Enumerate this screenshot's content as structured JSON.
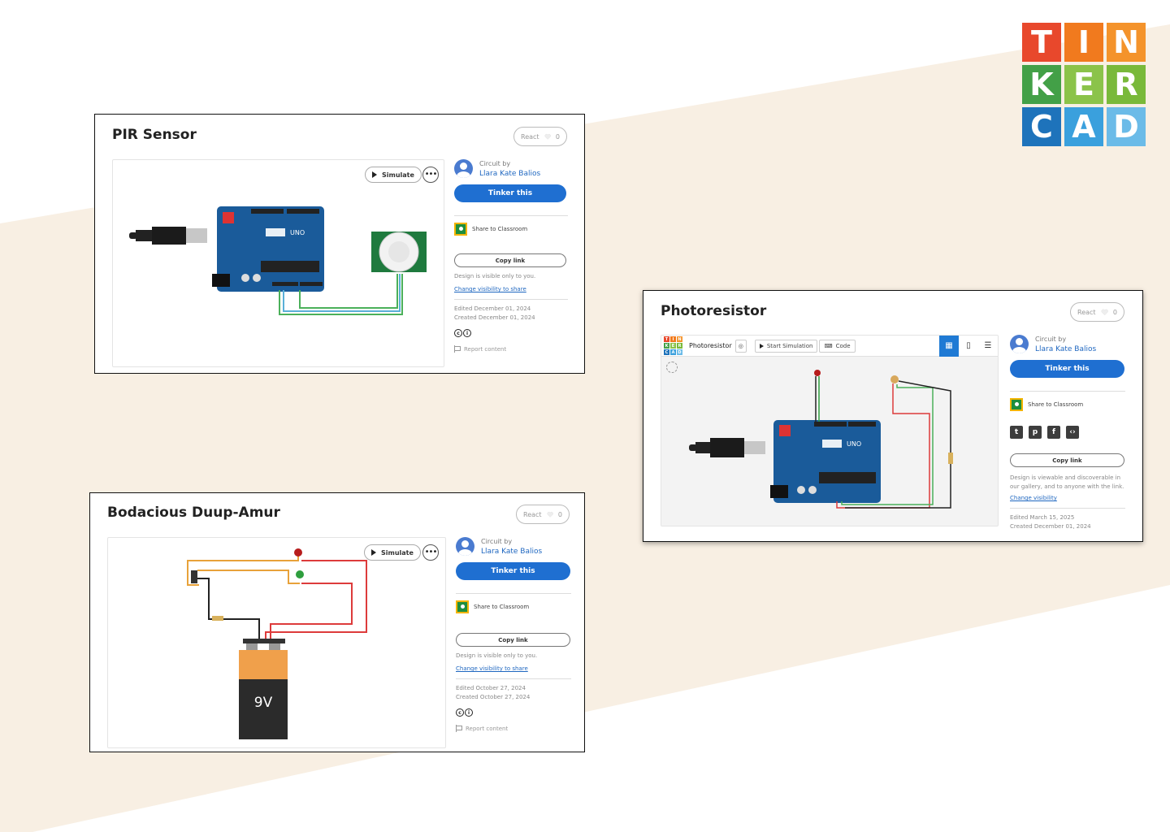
{
  "brand": {
    "logo_letters": [
      "T",
      "I",
      "N",
      "K",
      "E",
      "R",
      "C",
      "A",
      "D"
    ],
    "logo_colors": [
      "#e8482c",
      "#f17a1e",
      "#f4932b",
      "#43a047",
      "#8bc34a",
      "#79b93a",
      "#1e73bb",
      "#3aa0dd",
      "#6bbbe8"
    ]
  },
  "background": {
    "base": "#ffffff",
    "band": "#f8efe3"
  },
  "accent": "#1f6fd1",
  "cards": {
    "pir": {
      "title": "PIR Sensor",
      "react_label": "React",
      "react_count": "0",
      "simulate_label": "Simulate",
      "more_label": "•••",
      "circuit_by": "Circuit by",
      "author": "Llara Kate Balios",
      "tinker_label": "Tinker this",
      "classroom_label": "Share to Classroom",
      "copy_link_label": "Copy link",
      "visibility_text": "Design is visible only to you.",
      "visibility_link": "Change visibility to share",
      "edited": "Edited December 01, 2024",
      "created": "Created December 01, 2024",
      "report_label": "Report content"
    },
    "bodacious": {
      "title": "Bodacious Duup-Amur",
      "react_label": "React",
      "react_count": "0",
      "simulate_label": "Simulate",
      "more_label": "•••",
      "circuit_by": "Circuit by",
      "author": "Llara Kate Balios",
      "tinker_label": "Tinker this",
      "classroom_label": "Share to Classroom",
      "copy_link_label": "Copy link",
      "visibility_text": "Design is visible only to you.",
      "visibility_link": "Change visibility to share",
      "edited": "Edited October 27, 2024",
      "created": "Created October 27, 2024",
      "report_label": "Report content",
      "battery_label": "9V"
    },
    "photo": {
      "title": "Photoresistor",
      "react_label": "React",
      "react_count": "0",
      "editor_name": "Photoresistor",
      "start_sim_label": "Start Simulation",
      "code_label": "Code",
      "circuit_by": "Circuit by",
      "author": "Llara Kate Balios",
      "tinker_label": "Tinker this",
      "classroom_label": "Share to Classroom",
      "copy_link_label": "Copy link",
      "visibility_text": "Design is viewable and discoverable in our gallery, and to anyone with the link.",
      "visibility_link": "Change visibility",
      "edited": "Edited March 15, 2025",
      "created": "Created December 01, 2024",
      "social_icons": [
        "twitter-icon",
        "pinterest-icon",
        "facebook-icon",
        "embed-icon"
      ]
    }
  },
  "arduino": {
    "uno_label": "UNO",
    "brand_label": "ARDUINO",
    "digital_label": "DIGITAL (PWM~)",
    "power_label": "POWER",
    "analog_label": "ANALOG IN"
  }
}
